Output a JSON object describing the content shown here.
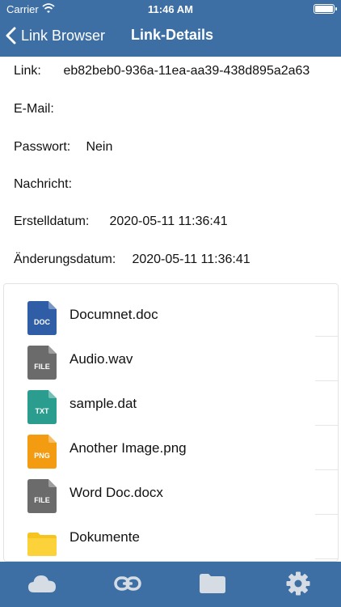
{
  "status_bar": {
    "carrier": "Carrier",
    "time": "11:46 AM"
  },
  "nav": {
    "back_label": "Link Browser",
    "title": "Link-Details"
  },
  "details": {
    "link_label": "Link:",
    "link_value": "eb82beb0-936a-11ea-aa39-438d895a2a63",
    "email_label": "E-Mail:",
    "email_value": "",
    "password_label": "Passwort:",
    "password_value": "Nein",
    "message_label": "Nachricht:",
    "message_value": "",
    "created_label": "Erstelldatum:",
    "created_value": "2020-05-11 11:36:41",
    "modified_label": "Änderungsdatum:",
    "modified_value": "2020-05-11 11:36:41"
  },
  "files": [
    {
      "name": "Documnet.doc",
      "badge": "DOC",
      "icon": "doc-file-icon",
      "color": "#2f5da6"
    },
    {
      "name": "Audio.wav",
      "badge": "FILE",
      "icon": "generic-file-icon",
      "color": "#6b6b6b"
    },
    {
      "name": "sample.dat",
      "badge": "TXT",
      "icon": "txt-file-icon",
      "color": "#2a9d8f"
    },
    {
      "name": "Another Image.png",
      "badge": "PNG",
      "icon": "png-file-icon",
      "color": "#f39c12"
    },
    {
      "name": "Word Doc.docx",
      "badge": "FILE",
      "icon": "generic-file-icon",
      "color": "#6b6b6b"
    },
    {
      "name": "Dokumente",
      "badge": "",
      "icon": "folder-icon",
      "color": "#f7c41f"
    }
  ],
  "tabs": [
    {
      "icon": "cloud-icon"
    },
    {
      "icon": "link-icon"
    },
    {
      "icon": "folder-icon"
    },
    {
      "icon": "gear-icon"
    }
  ],
  "colors": {
    "bar": "#3d6fa4",
    "tab_icon": "#d6dce4"
  }
}
